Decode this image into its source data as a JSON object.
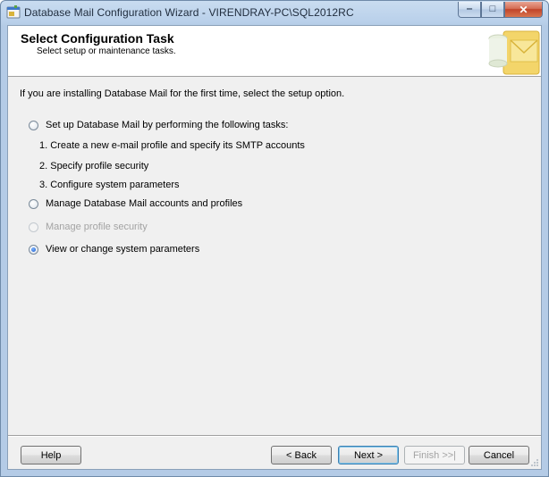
{
  "window": {
    "title": "Database Mail Configuration Wizard - VIRENDRAY-PC\\SQL2012RC",
    "app_icon": "wizard-app-icon",
    "minimize_glyph": "‒",
    "maximize_glyph": "□",
    "close_glyph": "✕"
  },
  "header": {
    "title": "Select Configuration Task",
    "subtitle": "Select setup or maintenance tasks.",
    "image": "database-mail-envelope-icon"
  },
  "content": {
    "intro": "If you are installing Database Mail for the first time, select the setup option.",
    "options": [
      {
        "label": "Set up Database Mail by performing the following tasks:",
        "checked": false,
        "enabled": true
      },
      {
        "label": "Manage Database Mail accounts and profiles",
        "checked": false,
        "enabled": true
      },
      {
        "label": "Manage profile security",
        "checked": false,
        "enabled": false
      },
      {
        "label": "View or change system parameters",
        "checked": true,
        "enabled": true
      }
    ],
    "steps": [
      "1. Create a new e-mail profile and specify its SMTP accounts",
      "2. Specify profile security",
      "3. Configure system parameters"
    ]
  },
  "buttons": {
    "help": "Help",
    "back": "< Back",
    "next": "Next >",
    "finish": "Finish >>|",
    "cancel": "Cancel"
  },
  "colors": {
    "title_bar": "#b9d0ea",
    "client": "#f0f0f0",
    "radio_checked": "#1656c8"
  }
}
